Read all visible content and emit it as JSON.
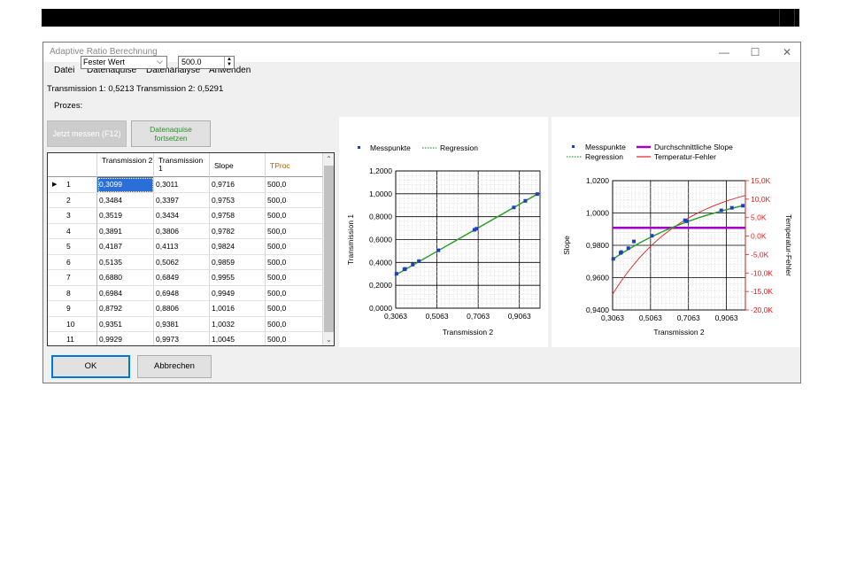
{
  "window": {
    "title": "Adaptive Ratio Berechnung",
    "minimize": "—",
    "maximize": "☐",
    "close": "✕"
  },
  "menu": [
    "Datei",
    "Datenaquise",
    "Datenanalyse",
    "Anwenden"
  ],
  "status": {
    "text": "Transmission 1: 0,5213  Transmission 2: 0,5291"
  },
  "controls": {
    "process_label": "Prozes:",
    "process_value": "Fester Wert",
    "temp_value": "500.0",
    "btn_disabled": "Jetzt messen (F12)",
    "btn_continue_1": "Datenaquise",
    "btn_continue_2": "fortsetzen"
  },
  "grid": {
    "headers": [
      "Transmission 2",
      "Transmission 1",
      "Slope",
      "TProc"
    ],
    "rows": [
      [
        "1",
        "0,3099",
        "0,3011",
        "0,9716",
        "500,0"
      ],
      [
        "2",
        "0,3484",
        "0,3397",
        "0,9753",
        "500,0"
      ],
      [
        "3",
        "0,3519",
        "0,3434",
        "0,9758",
        "500,0"
      ],
      [
        "4",
        "0,3891",
        "0,3806",
        "0,9782",
        "500,0"
      ],
      [
        "5",
        "0,4187",
        "0,4113",
        "0,9824",
        "500,0"
      ],
      [
        "6",
        "0,5135",
        "0,5062",
        "0,9859",
        "500,0"
      ],
      [
        "7",
        "0,6880",
        "0,6849",
        "0,9955",
        "500,0"
      ],
      [
        "8",
        "0,6984",
        "0,6948",
        "0,9949",
        "500,0"
      ],
      [
        "9",
        "0,8792",
        "0,8806",
        "1,0016",
        "500,0"
      ],
      [
        "10",
        "0,9351",
        "0,9381",
        "1,0032",
        "500,0"
      ],
      [
        "11",
        "0,9929",
        "0,9973",
        "1,0045",
        "500,0"
      ]
    ]
  },
  "buttons": {
    "ok": "OK",
    "cancel": "Abbrechen"
  },
  "colors": {
    "points": "#1f3fbf",
    "regression": "#2e9e2e",
    "avg_slope": "#a000c8",
    "temp_error": "#e02020"
  },
  "chart_data": [
    {
      "type": "scatter",
      "legend": [
        "Messpunkte",
        "Regression"
      ],
      "xlabel": "Transmission 2",
      "ylabel": "Transmission 1",
      "xlim": [
        0.3063,
        1.0063
      ],
      "ylim": [
        0.0,
        1.2
      ],
      "xticks": [
        "0,3063",
        "0,5063",
        "0,7063",
        "0,9063"
      ],
      "yticks": [
        "0,0000",
        "0,2000",
        "0,4000",
        "0,6000",
        "0,8000",
        "1,0000",
        "1,2000"
      ],
      "x": [
        0.3099,
        0.3484,
        0.3519,
        0.3891,
        0.4187,
        0.5135,
        0.688,
        0.6984,
        0.8792,
        0.9351,
        0.9929
      ],
      "y": [
        0.3011,
        0.3397,
        0.3434,
        0.3806,
        0.4113,
        0.5062,
        0.6849,
        0.6948,
        0.8806,
        0.9381,
        0.9973
      ]
    },
    {
      "type": "scatter",
      "legend": [
        "Messpunkte",
        "Durchschnittliche Slope",
        "Regression",
        "Temperatur-Fehler"
      ],
      "xlabel": "Transmission 2",
      "ylabel": "Slope",
      "y2label": "Temperatur-Fehler",
      "xlim": [
        0.3063,
        1.0063
      ],
      "ylim": [
        0.94,
        1.02
      ],
      "y2lim": [
        -20,
        15
      ],
      "xticks": [
        "0,3063",
        "0,5063",
        "0,7063",
        "0,9063"
      ],
      "yticks": [
        "0,9400",
        "0,9600",
        "0,9800",
        "1,0000",
        "1,0200"
      ],
      "y2ticks": [
        "15,0K",
        "10,0K",
        "5,0K",
        "0,0K",
        "-5,0K",
        "-10,0K",
        "-15,0K",
        "-20,0K"
      ],
      "x": [
        0.3099,
        0.3484,
        0.3519,
        0.3891,
        0.4187,
        0.5135,
        0.688,
        0.6984,
        0.8792,
        0.9351,
        0.9929
      ],
      "y": [
        0.9716,
        0.9753,
        0.9758,
        0.9782,
        0.9824,
        0.9859,
        0.9955,
        0.9949,
        1.0016,
        1.0032,
        1.0045
      ],
      "avg_slope": 0.9908
    }
  ]
}
